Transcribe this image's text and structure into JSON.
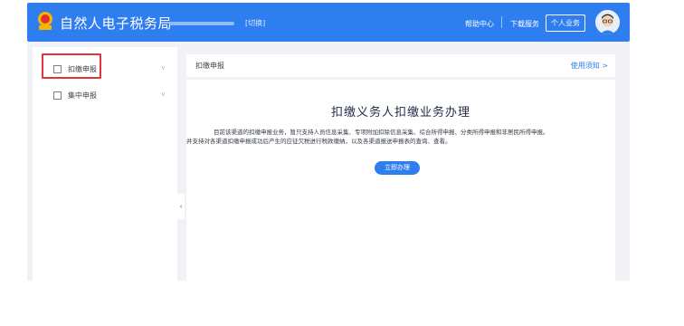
{
  "header": {
    "site_title": "自然人电子税务局",
    "switch_label": "[切换]",
    "help_label": "帮助中心",
    "download_label": "下载服务",
    "personal_label": "个人业务"
  },
  "sidebar": {
    "items": [
      {
        "label": "扣缴申报",
        "chevron": "∨"
      },
      {
        "label": "集中申报",
        "chevron": "∨"
      }
    ],
    "collapse_glyph": "‹"
  },
  "main": {
    "breadcrumb": "扣缴申报",
    "usage_link": "使用须知 >",
    "title": "扣缴义务人扣缴业务办理",
    "desc_line1": "目前该渠道的扣缴申报业务，暂只支持人员信息采集、专项附加扣除信息采集、综合所得申报、分类所得申报和非居民所得申报。",
    "desc_line2": "并支持对各渠道扣缴申报成功后产生的应征欠税进行税款缴纳，以及各渠道报送申报表的查询、查看。",
    "action_button": "立即办理"
  },
  "colors": {
    "accent": "#2f7ef0",
    "highlight": "#e0353b"
  },
  "icons": {
    "logo": "tax-emblem-icon",
    "avatar": "user-avatar-icon",
    "side_item_1": "document-icon",
    "side_item_2": "grid-icon"
  }
}
